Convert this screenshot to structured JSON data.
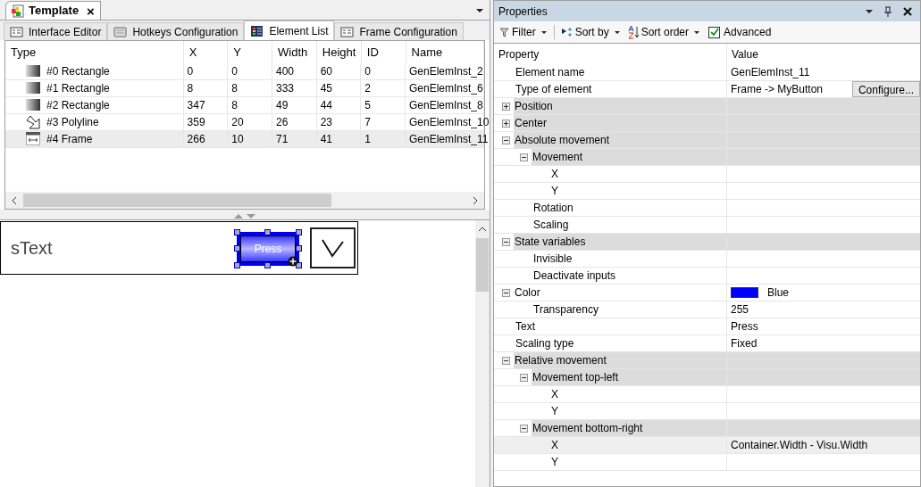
{
  "document_tab": {
    "title": "Template",
    "close": "×"
  },
  "editor_tabs": [
    {
      "label": "Interface Editor",
      "selected": false
    },
    {
      "label": "Hotkeys Configuration",
      "selected": false
    },
    {
      "label": "Element List",
      "selected": true
    },
    {
      "label": "Frame Configuration",
      "selected": false
    }
  ],
  "element_table": {
    "columns": [
      "Type",
      "X",
      "Y",
      "Width",
      "Height",
      "ID",
      "Name"
    ],
    "rows": [
      {
        "kind": "rectangle",
        "selected": false,
        "cells": [
          "#0 Rectangle",
          "0",
          "0",
          "400",
          "60",
          "0",
          "GenElemInst_2"
        ]
      },
      {
        "kind": "rectangle",
        "selected": false,
        "cells": [
          "#1 Rectangle",
          "8",
          "8",
          "333",
          "45",
          "2",
          "GenElemInst_6"
        ]
      },
      {
        "kind": "rectangle",
        "selected": false,
        "cells": [
          "#2 Rectangle",
          "347",
          "8",
          "49",
          "44",
          "5",
          "GenElemInst_8"
        ]
      },
      {
        "kind": "polyline",
        "selected": false,
        "cells": [
          "#3 Polyline",
          "359",
          "20",
          "26",
          "23",
          "7",
          "GenElemInst_10"
        ]
      },
      {
        "kind": "frame",
        "selected": true,
        "cells": [
          "#4 Frame",
          "266",
          "10",
          "71",
          "41",
          "1",
          "GenElemInst_11"
        ]
      }
    ]
  },
  "canvas": {
    "label": "sText",
    "button_text": "Press"
  },
  "properties": {
    "title": "Properties",
    "toolbar": {
      "filter": "Filter",
      "sort_by": "Sort by",
      "sort_order": "Sort order",
      "advanced": {
        "label": "Advanced",
        "checked": true
      }
    },
    "columns": [
      "Property",
      "Value"
    ],
    "rows": [
      {
        "kind": "property",
        "label": "Element name",
        "value": "GenElemInst_11"
      },
      {
        "kind": "property",
        "label": "Type of element",
        "value": "Frame -> MyButton",
        "button": "Configure..."
      },
      {
        "kind": "category",
        "label": "Position",
        "expanded": false
      },
      {
        "kind": "category",
        "label": "Center",
        "expanded": false
      },
      {
        "kind": "category",
        "label": "Absolute movement",
        "expanded": true,
        "children": [
          {
            "kind": "category",
            "label": "Movement",
            "expanded": true,
            "children": [
              {
                "kind": "property",
                "label": "X"
              },
              {
                "kind": "property",
                "label": "Y"
              }
            ]
          },
          {
            "kind": "property",
            "label": "Rotation"
          },
          {
            "kind": "property",
            "label": "Scaling"
          }
        ]
      },
      {
        "kind": "category",
        "label": "State variables",
        "expanded": true,
        "children": [
          {
            "kind": "property",
            "label": "Invisible"
          },
          {
            "kind": "property",
            "label": "Deactivate inputs"
          }
        ]
      },
      {
        "kind": "property",
        "label": "Color",
        "expanded": true,
        "value": "Blue",
        "color": "#0000ff",
        "children": [
          {
            "kind": "property",
            "label": "Transparency",
            "value": "255"
          }
        ]
      },
      {
        "kind": "property",
        "label": "Text",
        "value": "Press"
      },
      {
        "kind": "property",
        "label": "Scaling type",
        "value": "Fixed"
      },
      {
        "kind": "category",
        "label": "Relative movement",
        "expanded": true,
        "children": [
          {
            "kind": "category",
            "label": "Movement top-left",
            "expanded": true,
            "children": [
              {
                "kind": "property",
                "label": "X"
              },
              {
                "kind": "property",
                "label": "Y"
              }
            ]
          },
          {
            "kind": "category",
            "label": "Movement bottom-right",
            "expanded": true,
            "children": [
              {
                "kind": "property",
                "label": "X",
                "value": "Container.Width - Visu.Width",
                "selected": true
              },
              {
                "kind": "property",
                "label": "Y"
              }
            ]
          }
        ]
      }
    ]
  }
}
